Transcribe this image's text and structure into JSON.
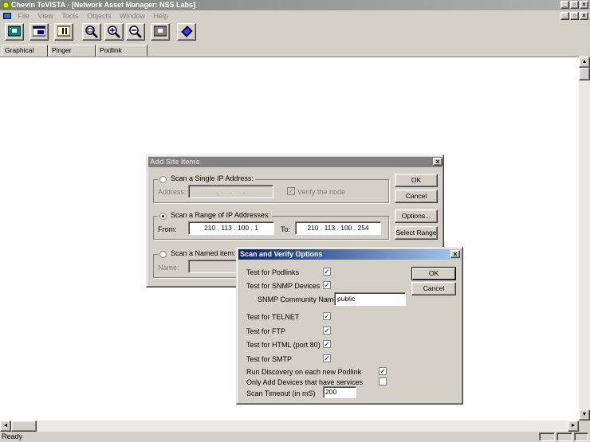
{
  "app": {
    "title": "Chevin TeVISTA - [Network Asset Manager: NSS Labs]",
    "menu": [
      "File",
      "View",
      "Tools",
      "Objects",
      "Window",
      "Help"
    ],
    "status": "Ready"
  },
  "toolbar": {
    "buttons": [
      "map-icon",
      "window-icon",
      "panel-icon",
      "zoom-fit-icon",
      "zoom-in-icon",
      "zoom-out-icon",
      "grid-icon",
      "book-icon"
    ]
  },
  "tabs": [
    "Graphical Map",
    "Pinger Controls",
    "Podlink Controls"
  ],
  "add_site": {
    "title": "Add Site Items",
    "single": {
      "label": "Scan a Single IP Address:",
      "address_label": "Address:",
      "address_value": ". . .",
      "verify_label": "Verify the node"
    },
    "range": {
      "label": "Scan a Range of IP Addresses:",
      "from_label": "From:",
      "from_value": "210 . 113 . 100 . 1",
      "to_label": "To:",
      "to_value": "210 . 113 . 100 . 254"
    },
    "named": {
      "label": "Scan a Named item:",
      "name_label": "Name:"
    },
    "buttons": {
      "ok": "OK",
      "cancel": "Cancel",
      "options": "Options...",
      "select_range": "Select Range"
    }
  },
  "scan_options": {
    "title": "Scan and Verify Options",
    "items": [
      {
        "label": "Test for Podlinks",
        "checked": true
      },
      {
        "label": "Test for SNMP Devices",
        "checked": true
      },
      {
        "label": "Test for TELNET",
        "checked": true
      },
      {
        "label": "Test for FTP",
        "checked": true
      },
      {
        "label": "Test for HTML (port 80)",
        "checked": true
      },
      {
        "label": "Test for SMTP",
        "checked": true
      },
      {
        "label": "Run Discovery on each new Podlink",
        "checked": true
      },
      {
        "label": "Only Add Devices that have services",
        "checked": false
      }
    ],
    "community_label": "SNMP Community Name:",
    "community_value": "public",
    "timeout_label": "Scan Timeout (in mS)",
    "timeout_value": "200",
    "buttons": {
      "ok": "OK",
      "cancel": "Cancel"
    }
  },
  "colors": {
    "inactive_title": "#808080",
    "active_title": "#0a246a",
    "face": "#d4d0c8"
  }
}
